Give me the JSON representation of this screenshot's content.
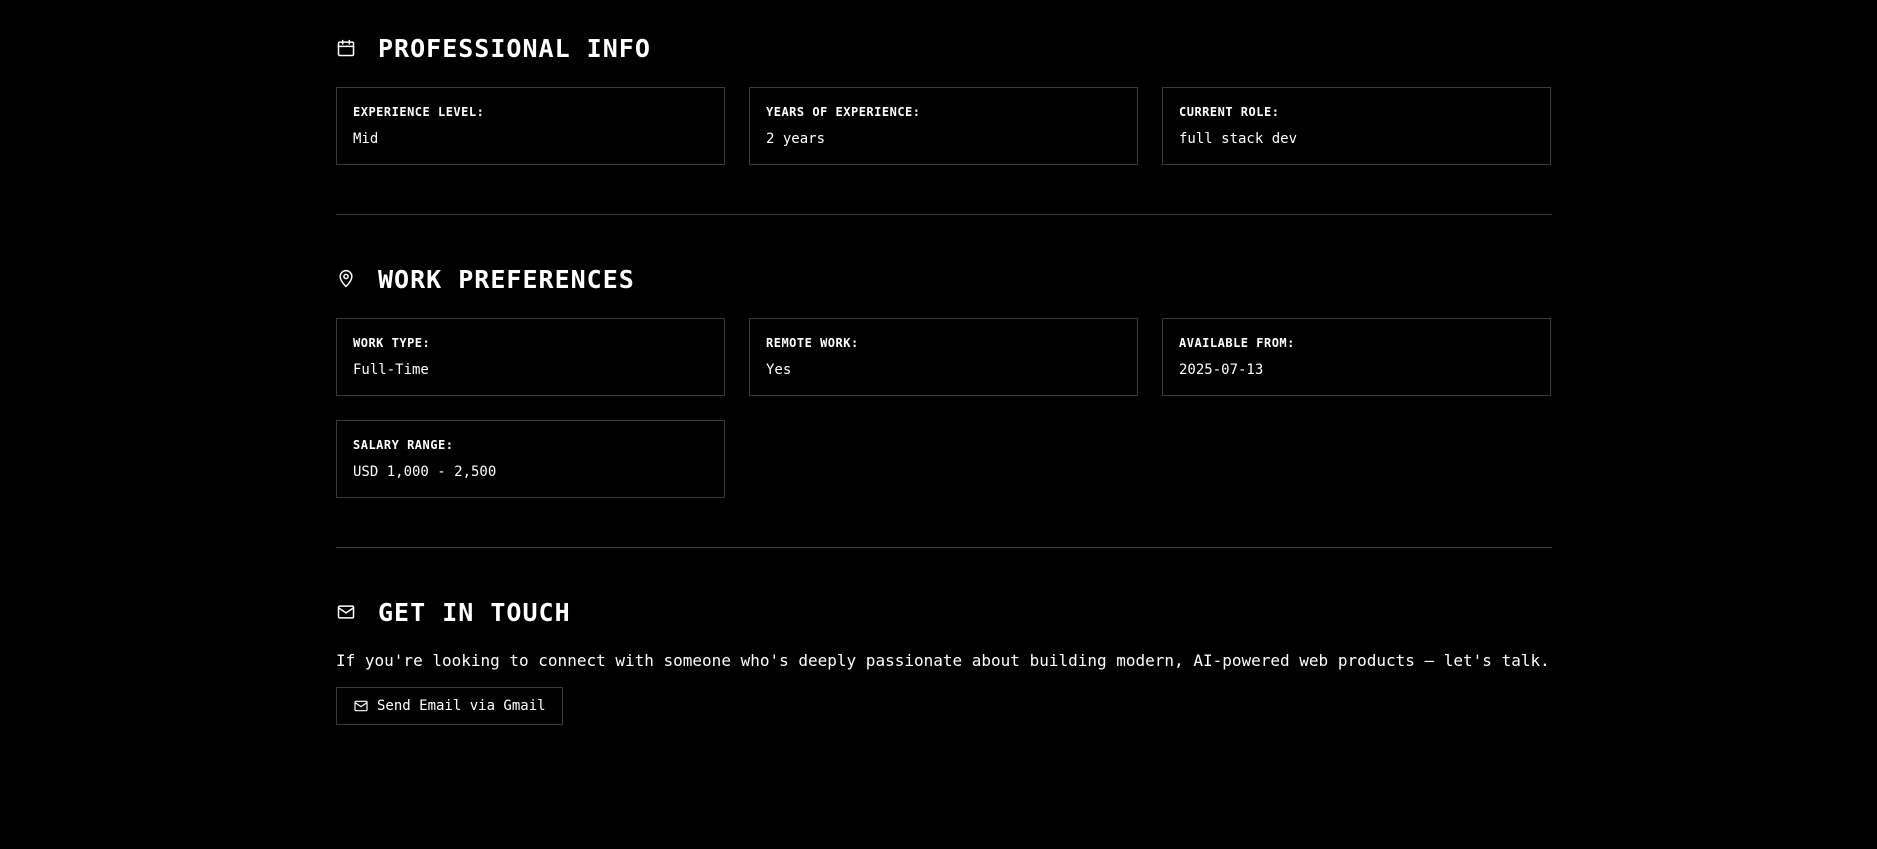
{
  "professional": {
    "icon": "calendar-icon",
    "title": "PROFESSIONAL INFO",
    "cards": [
      {
        "label": "EXPERIENCE LEVEL:",
        "value": "Mid"
      },
      {
        "label": "YEARS OF EXPERIENCE:",
        "value": "2 years"
      },
      {
        "label": "CURRENT ROLE:",
        "value": "full stack dev"
      }
    ]
  },
  "preferences": {
    "icon": "map-pin-icon",
    "title": "WORK PREFERENCES",
    "cards": [
      {
        "label": "WORK TYPE:",
        "value": "Full-Time"
      },
      {
        "label": "REMOTE WORK:",
        "value": "Yes"
      },
      {
        "label": "AVAILABLE FROM:",
        "value": "2025-07-13"
      },
      {
        "label": "SALARY RANGE:",
        "value": "USD 1,000 - 2,500"
      }
    ]
  },
  "contact": {
    "icon": "mail-icon",
    "title": "GET IN TOUCH",
    "text": "If you're looking to connect with someone who's deeply passionate about building modern, AI-powered web products — let's talk.",
    "button_label": "Send Email via Gmail"
  },
  "colors": {
    "background": "#000000",
    "text": "#ffffff",
    "border": "#3a3a3a"
  }
}
